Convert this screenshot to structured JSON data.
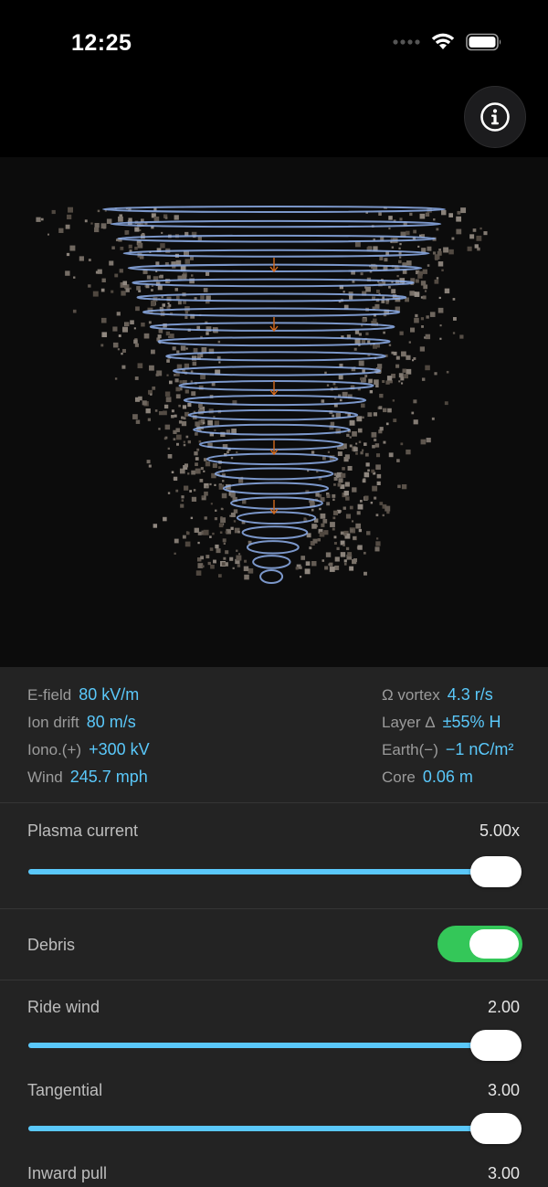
{
  "status": {
    "time": "12:25"
  },
  "stats": {
    "e_field": {
      "label": "E-field",
      "value": "80 kV/m"
    },
    "ion_drift": {
      "label": "Ion drift",
      "value": "80 m/s"
    },
    "iono": {
      "label": "Iono.(+)",
      "value": "+300 kV"
    },
    "wind": {
      "label": "Wind",
      "value": "245.7 mph"
    },
    "vortex": {
      "label": "Ω vortex",
      "value": "4.3 r/s"
    },
    "layer": {
      "label": "Layer Δ",
      "value": "±55% H"
    },
    "earth": {
      "label": "Earth(−)",
      "value": "−1 nC/m²"
    },
    "core": {
      "label": "Core",
      "value": "0.06 m"
    }
  },
  "controls": {
    "plasma_current": {
      "label": "Plasma current",
      "value": "5.00x",
      "level": 1.0
    },
    "debris": {
      "label": "Debris",
      "on": true
    },
    "ride_wind": {
      "label": "Ride wind",
      "value": "2.00",
      "level": 1.0
    },
    "tangential": {
      "label": "Tangential",
      "value": "3.00",
      "level": 1.0
    },
    "inward_pull": {
      "label": "Inward pull",
      "value": "3.00"
    }
  },
  "colors": {
    "accent": "#5ac8fa",
    "toggle_on": "#34c759",
    "ring": "#8fb0ec"
  }
}
